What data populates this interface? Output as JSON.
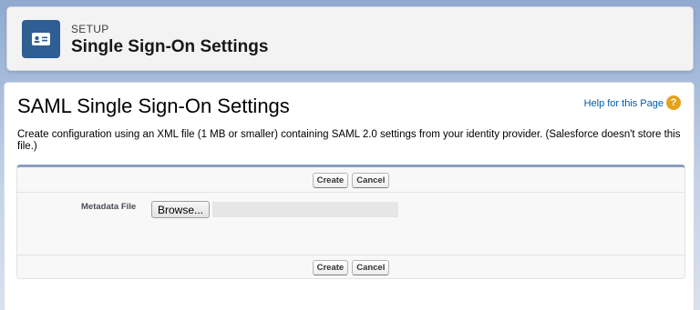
{
  "header": {
    "eyebrow": "SETUP",
    "title": "Single Sign-On Settings",
    "icon": "id-card-icon",
    "accent_color": "#2e5e94"
  },
  "main": {
    "page_title": "SAML Single Sign-On Settings",
    "help_link": "Help for this Page",
    "help_icon_glyph": "?",
    "description": "Create configuration using an XML file (1 MB or smaller) containing SAML 2.0 settings from your identity provider. (Salesforce doesn't store this file.)"
  },
  "form": {
    "create_label": "Create",
    "cancel_label": "Cancel",
    "metadata_label": "Metadata File",
    "browse_label": "Browse...",
    "file_path_value": ""
  }
}
